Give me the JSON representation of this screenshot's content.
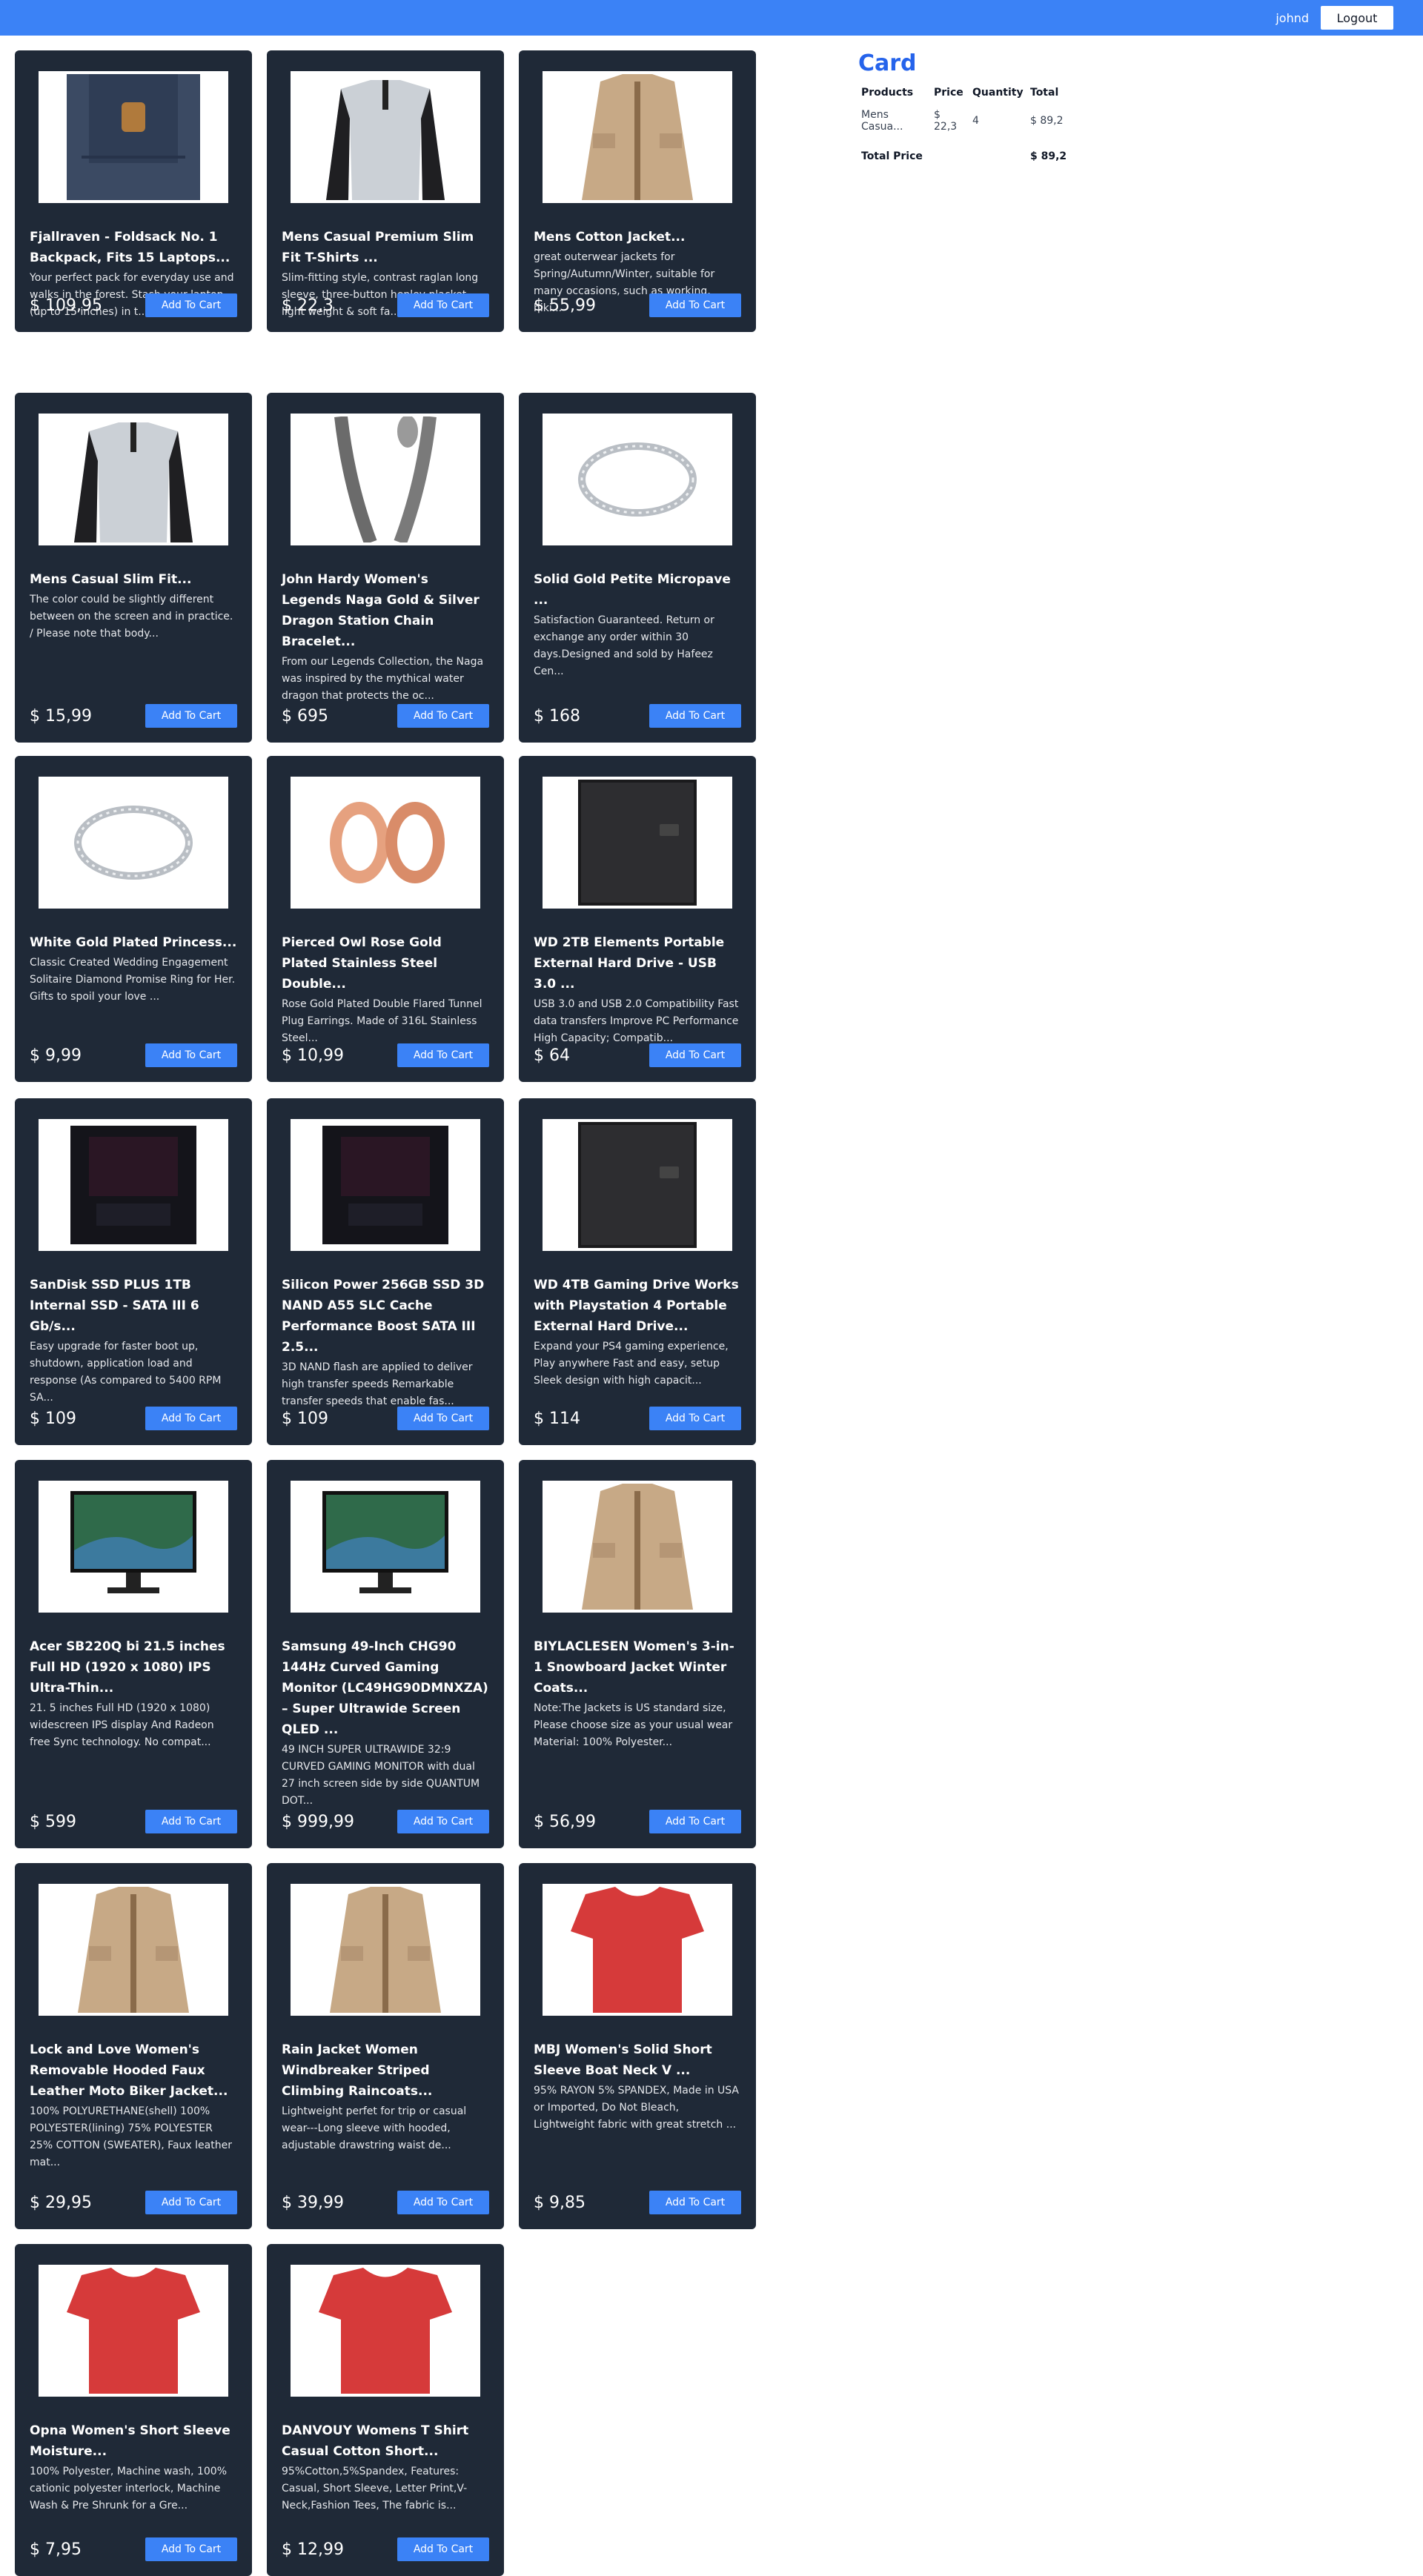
{
  "header": {
    "username": "johnd",
    "logout_label": "Logout"
  },
  "cart": {
    "title": "Card",
    "columns": [
      "Products",
      "Price",
      "Quantity",
      "Total"
    ],
    "items": [
      {
        "product": "Mens Casua...",
        "price": "$ 22,3",
        "quantity": "4",
        "total": "$ 89,2"
      }
    ],
    "total_label": "Total Price",
    "total_value": "$ 89,2"
  },
  "add_to_cart_label": "Add To Cart",
  "products": [
    {
      "title": "Fjallraven - Foldsack No. 1 Backpack, Fits 15 Laptops...",
      "description": "Your perfect pack for everyday use and walks in the forest. Stash your laptop (up to 15 inches) in t...",
      "price": "$ 109,95",
      "icon": "backpack-icon"
    },
    {
      "title": "Mens Casual Premium Slim Fit T-Shirts ...",
      "description": "Slim-fitting style, contrast raglan long sleeve, three-button henley placket, light weight & soft fa...",
      "price": "$ 22,3",
      "icon": "shirt-icon"
    },
    {
      "title": "Mens Cotton Jacket...",
      "description": "great outerwear jackets for Spring/Autumn/Winter, suitable for many occasions, such as working, hiki...",
      "price": "$ 55,99",
      "icon": "jacket-icon"
    },
    {
      "title": "Mens Casual Slim Fit...",
      "description": "The color could be slightly different between on the screen and in practice. / Please note that body...",
      "price": "$ 15,99",
      "icon": "shirt-icon"
    },
    {
      "title": "John Hardy Women's Legends Naga Gold & Silver Dragon Station Chain Bracelet...",
      "description": "From our Legends Collection, the Naga was inspired by the mythical water dragon that protects the oc...",
      "price": "$ 695",
      "icon": "bracelet-icon"
    },
    {
      "title": "Solid Gold Petite Micropave ...",
      "description": "Satisfaction Guaranteed. Return or exchange any order within 30 days.Designed and sold by Hafeez Cen...",
      "price": "$ 168",
      "icon": "ring-icon"
    },
    {
      "title": "White Gold Plated Princess...",
      "description": "Classic Created Wedding Engagement Solitaire Diamond Promise Ring for Her. Gifts to spoil your love ...",
      "price": "$ 9,99",
      "icon": "ring-icon"
    },
    {
      "title": "Pierced Owl Rose Gold Plated Stainless Steel Double...",
      "description": "Rose Gold Plated Double Flared Tunnel Plug Earrings. Made of 316L Stainless Steel...",
      "price": "$ 10,99",
      "icon": "earrings-icon"
    },
    {
      "title": "WD 2TB Elements Portable External Hard Drive - USB 3.0 ...",
      "description": "USB 3.0 and USB 2.0 Compatibility Fast data transfers Improve PC Performance High Capacity; Compatib...",
      "price": "$ 64",
      "icon": "hard-drive-icon"
    },
    {
      "title": "SanDisk SSD PLUS 1TB Internal SSD - SATA III 6 Gb/s...",
      "description": "Easy upgrade for faster boot up, shutdown, application load and response (As compared to 5400 RPM SA...",
      "price": "$ 109",
      "icon": "ssd-icon"
    },
    {
      "title": "Silicon Power 256GB SSD 3D NAND A55 SLC Cache Performance Boost SATA III 2.5...",
      "description": "3D NAND flash are applied to deliver high transfer speeds Remarkable transfer speeds that enable fas...",
      "price": "$ 109",
      "icon": "ssd-icon"
    },
    {
      "title": "WD 4TB Gaming Drive Works with Playstation 4 Portable External Hard Drive...",
      "description": "Expand your PS4 gaming experience, Play anywhere Fast and easy, setup Sleek design with high capacit...",
      "price": "$ 114",
      "icon": "hard-drive-icon"
    },
    {
      "title": "Acer SB220Q bi 21.5 inches Full HD (1920 x 1080) IPS Ultra-Thin...",
      "description": "21. 5 inches Full HD (1920 x 1080) widescreen IPS display And Radeon free Sync technology. No compat...",
      "price": "$ 599",
      "icon": "monitor-icon"
    },
    {
      "title": "Samsung 49-Inch CHG90 144Hz Curved Gaming Monitor (LC49HG90DMNXZA) – Super Ultrawide Screen QLED ...",
      "description": "49 INCH SUPER ULTRAWIDE 32:9 CURVED GAMING MONITOR with dual 27 inch screen side by side QUANTUM DOT...",
      "price": "$ 999,99",
      "icon": "monitor-icon"
    },
    {
      "title": "BIYLACLESEN Women's 3-in-1 Snowboard Jacket Winter Coats...",
      "description": "Note:The Jackets is US standard size, Please choose size as your usual wear Material: 100% Polyester...",
      "price": "$ 56,99",
      "icon": "jacket-icon"
    },
    {
      "title": "Lock and Love Women's Removable Hooded Faux Leather Moto Biker Jacket...",
      "description": "100% POLYURETHANE(shell) 100% POLYESTER(lining) 75% POLYESTER 25% COTTON (SWEATER), Faux leather mat...",
      "price": "$ 29,95",
      "icon": "jacket-icon"
    },
    {
      "title": "Rain Jacket Women Windbreaker Striped Climbing Raincoats...",
      "description": "Lightweight perfet for trip or casual wear---Long sleeve with hooded, adjustable drawstring waist de...",
      "price": "$ 39,99",
      "icon": "jacket-icon"
    },
    {
      "title": "MBJ Women's Solid Short Sleeve Boat Neck V ...",
      "description": "95% RAYON 5% SPANDEX, Made in USA or Imported, Do Not Bleach, Lightweight fabric with great stretch ...",
      "price": "$ 9,85",
      "icon": "tshirt-icon"
    },
    {
      "title": "Opna Women's Short Sleeve Moisture...",
      "description": "100% Polyester, Machine wash, 100% cationic polyester interlock, Machine Wash & Pre Shrunk for a Gre...",
      "price": "$ 7,95",
      "icon": "tshirt-icon"
    },
    {
      "title": "DANVOUY Womens T Shirt Casual Cotton Short...",
      "description": "95%Cotton,5%Spandex, Features: Casual, Short Sleeve, Letter Print,V-Neck,Fashion Tees, The fabric is...",
      "price": "$ 12,99",
      "icon": "tshirt-icon"
    }
  ]
}
